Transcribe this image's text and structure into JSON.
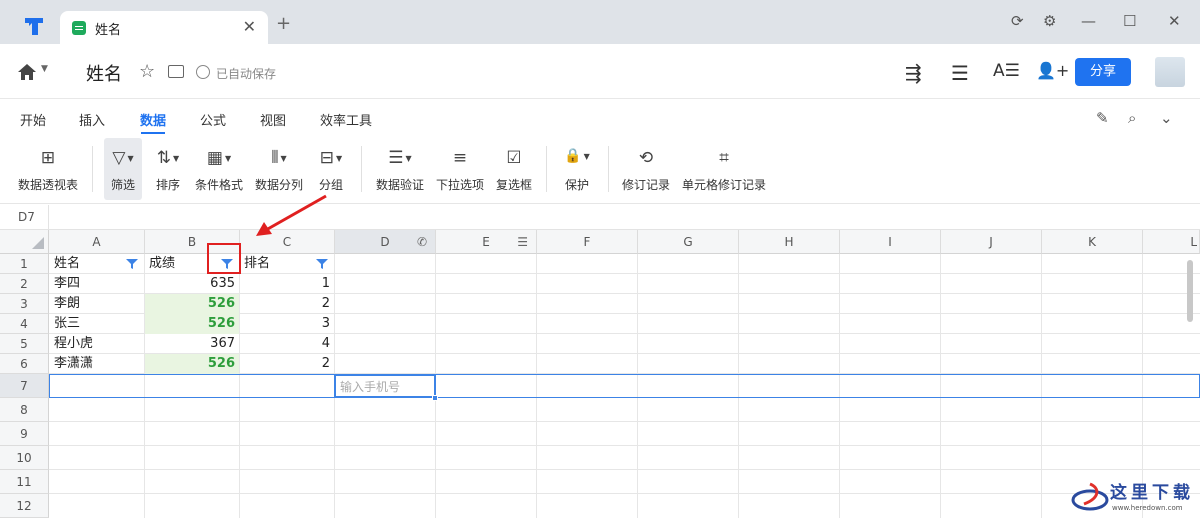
{
  "tab": {
    "title": "姓名",
    "close": "✕",
    "new": "+"
  },
  "window": {
    "refresh": "⟳",
    "settings": "⚙",
    "minimize": "—",
    "maximize": "☐",
    "close": "✕"
  },
  "header": {
    "doc_title": "姓名",
    "save_status": "已自动保存",
    "share_label": "分享",
    "tools_icon": "⇶",
    "menu_icon": "☰",
    "font_icon": "A☰",
    "add_user_icon": "👤+"
  },
  "menu": {
    "tabs": [
      "开始",
      "插入",
      "数据",
      "公式",
      "视图",
      "效率工具"
    ],
    "active": "数据"
  },
  "ribbon": [
    {
      "label": "数据透视表",
      "icon": "⊞"
    },
    {
      "label": "筛选",
      "icon": "▽",
      "active": true
    },
    {
      "label": "排序",
      "icon": "⇅"
    },
    {
      "label": "条件格式",
      "icon": "▦"
    },
    {
      "label": "数据分列",
      "icon": "⫴"
    },
    {
      "label": "分组",
      "icon": "⊟"
    },
    {
      "label": "数据验证",
      "icon": "☰"
    },
    {
      "label": "下拉选项",
      "icon": "≡"
    },
    {
      "label": "复选框",
      "icon": "☑"
    },
    {
      "label": "保护",
      "icon": "🔒"
    },
    {
      "label": "修订记录",
      "icon": "⟲"
    },
    {
      "label": "单元格修订记录",
      "icon": "⌗"
    }
  ],
  "formula_bar": {
    "cell_ref": "D7"
  },
  "sheet": {
    "columns": [
      "A",
      "B",
      "C",
      "D",
      "E",
      "F",
      "G",
      "H",
      "I",
      "J",
      "K",
      "L"
    ],
    "rows": [
      "1",
      "2",
      "3",
      "4",
      "5",
      "6",
      "7",
      "8",
      "9",
      "10",
      "11",
      "12"
    ],
    "headers": [
      "姓名",
      "成绩",
      "排名"
    ],
    "data": [
      {
        "name": "李四",
        "score": "635",
        "rank": "1",
        "highlight": false
      },
      {
        "name": "李朗",
        "score": "526",
        "rank": "2",
        "highlight": true
      },
      {
        "name": "张三",
        "score": "526",
        "rank": "3",
        "highlight": true
      },
      {
        "name": "程小虎",
        "score": "367",
        "rank": "4",
        "highlight": false
      },
      {
        "name": "李潇潇",
        "score": "526",
        "rank": "2",
        "highlight": true
      }
    ],
    "active_cell_placeholder": "输入手机号",
    "highlight_color": "#e9f5e1",
    "highlight_text_color": "#2e9e3c"
  },
  "watermark": {
    "text": "这里下载",
    "url": "www.heredown.com"
  },
  "colors": {
    "accent": "#1f73f0",
    "annotation": "#e02020"
  }
}
